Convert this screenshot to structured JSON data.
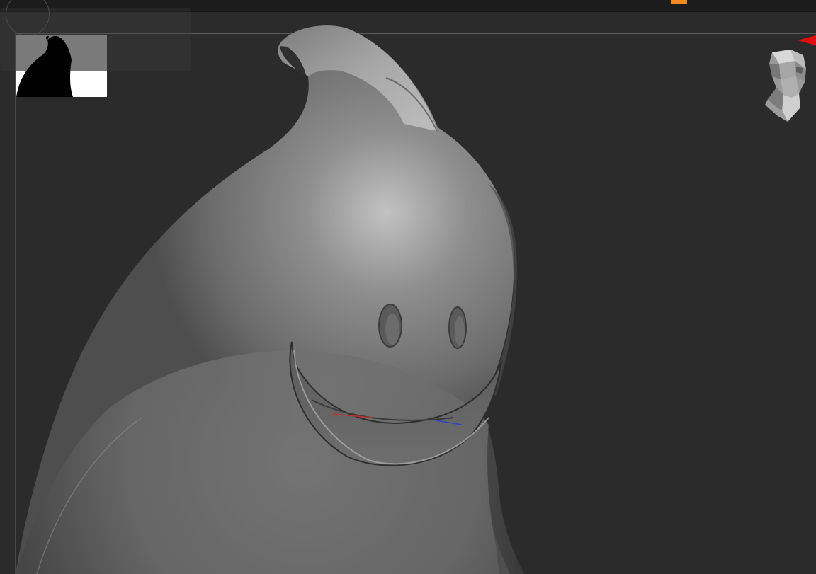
{
  "app": {
    "name": "",
    "background_color": "#2b2b2b"
  },
  "topbar": {
    "background_color": "#1c1c1c",
    "activity_indicator_color": "#f28a1e"
  },
  "viewport": {
    "model": {
      "description_icon": "ghost-sculpt-model",
      "surface_color": "#8a8a8a",
      "highlight_color": "#c4c4c4",
      "shadow_color": "#3a3a3a"
    },
    "gizmo": {
      "x_axis_color": "#c03030",
      "z_axis_color": "#3040c0"
    }
  },
  "navigation": {
    "head_icon": "head-navigation-gizmo-icon",
    "marker_color": "#e01010"
  },
  "thumbnail": {
    "icon": "silhouette-thumbnail",
    "silhouette_color": "#000000",
    "top_color": "#7a7a7a",
    "bottom_color": "#ffffff"
  }
}
